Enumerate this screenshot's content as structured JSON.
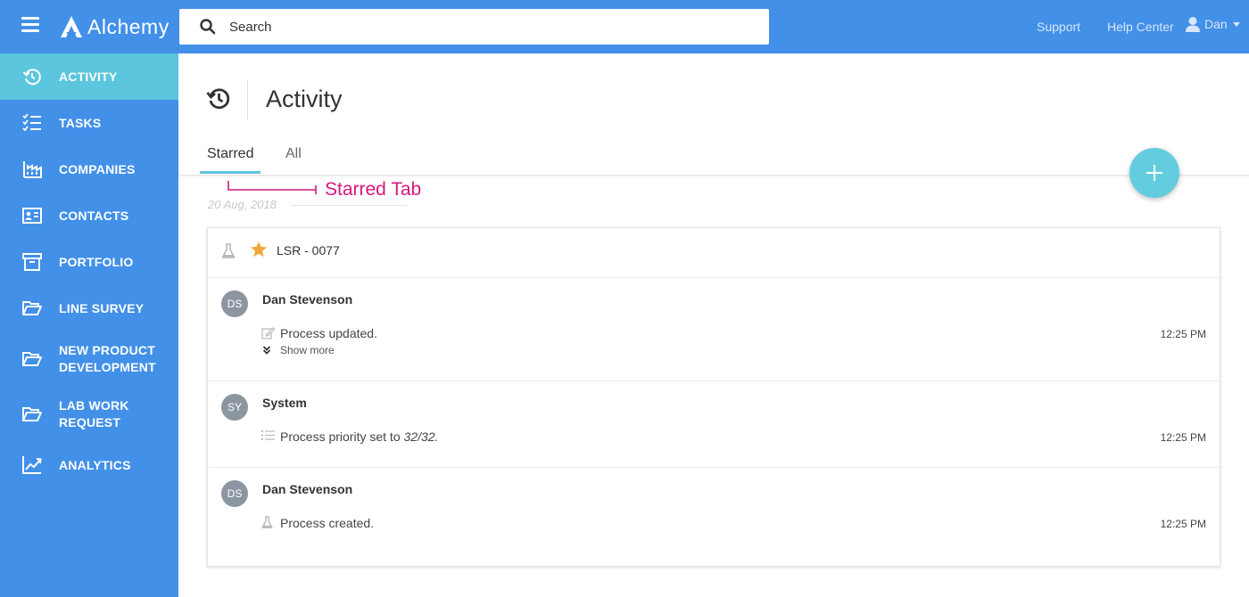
{
  "topbar": {
    "brand": "Alchemy",
    "search_placeholder": "Search",
    "links": [
      "Support",
      "Help Center"
    ],
    "user_name": "Dan",
    "bg_color": "#4290e8"
  },
  "sidebar": {
    "items": [
      {
        "label": "ACTIVITY",
        "icon": "history-icon",
        "active": true
      },
      {
        "label": "TASKS",
        "icon": "tasks-icon"
      },
      {
        "label": "COMPANIES",
        "icon": "factory-icon"
      },
      {
        "label": "CONTACTS",
        "icon": "contact-card-icon"
      },
      {
        "label": "PORTFOLIO",
        "icon": "archive-icon"
      },
      {
        "label": "LINE SURVEY",
        "icon": "folder-open-icon"
      },
      {
        "label_lines": [
          "NEW PRODUCT",
          "DEVELOPMENT"
        ],
        "icon": "folder-open-icon"
      },
      {
        "label_lines": [
          "LAB WORK",
          "REQUEST"
        ],
        "icon": "folder-open-icon"
      },
      {
        "label": "ANALYTICS",
        "icon": "chart-line-icon"
      }
    ],
    "active_color": "#5bc6dd"
  },
  "page": {
    "title": "Activity",
    "tabs": [
      {
        "label": "Starred",
        "selected": true
      },
      {
        "label": "All",
        "selected": false
      }
    ],
    "annotation": "Starred Tab",
    "date": "20 Aug, 2018"
  },
  "card": {
    "process_id": "LSR - 0077",
    "starred": true,
    "entries": [
      {
        "initials": "DS",
        "author": "Dan Stevenson",
        "icon": "edit-icon",
        "message": "Process updated.",
        "time": "12:25 PM",
        "show_more": "Show more"
      },
      {
        "initials": "SY",
        "author": "System",
        "icon": "list-icon",
        "message_prefix": "Process priority set to ",
        "message_value": "32/32",
        "message_suffix": ".",
        "time": "12:25 PM"
      },
      {
        "initials": "DS",
        "author": "Dan Stevenson",
        "icon": "flask-icon",
        "message": "Process created.",
        "time": "12:25 PM"
      }
    ]
  }
}
